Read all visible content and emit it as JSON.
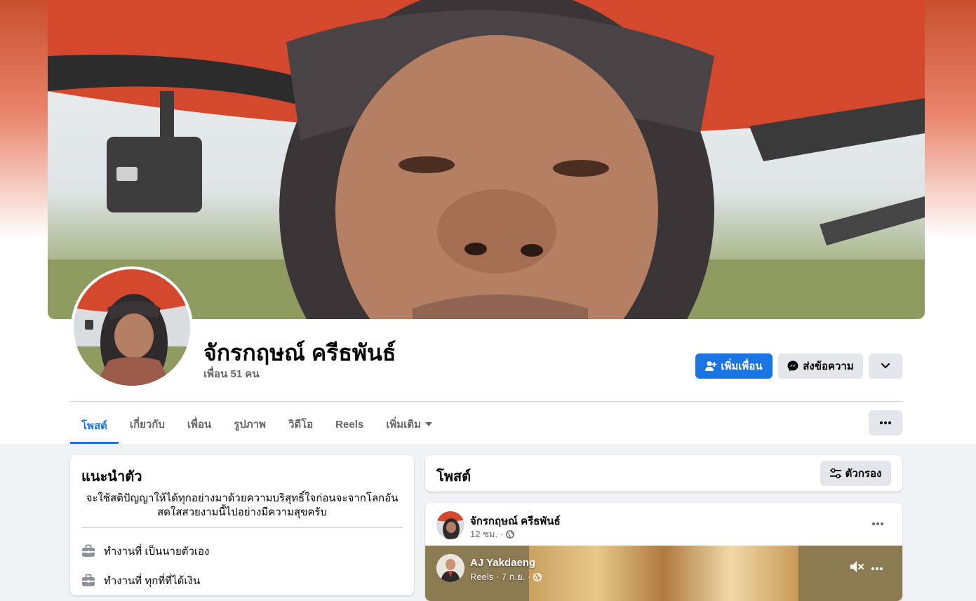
{
  "profile": {
    "name": "จักรกฤษณ์ ครีธพันธ์",
    "friends_count": "เพื่อน 51 คน"
  },
  "actions": {
    "add_friend": "เพิ่มเพื่อน",
    "message": "ส่งข้อความ"
  },
  "tabs": [
    {
      "label": "โพสต์",
      "active": true
    },
    {
      "label": "เกี่ยวกับ"
    },
    {
      "label": "เพื่อน"
    },
    {
      "label": "รูปภาพ"
    },
    {
      "label": "วิดีโอ"
    },
    {
      "label": "Reels"
    },
    {
      "label": "เพิ่มเติม"
    }
  ],
  "intro": {
    "title": "แนะนำตัว",
    "bio": "จะใช้สติปัญญาให้ได้ทุกอย่างมาด้วยความบริสุทธิ์ใจก่อนจะจากโลกอันสดใสสวยงามนี้ไปอย่างมีความสุขครับ",
    "items": [
      {
        "icon": "briefcase-icon",
        "text": "ทำงานที่ เป็นนายตัวเอง"
      },
      {
        "icon": "briefcase-icon",
        "text": "ทำงานที่ ทุกที่ที่ได้เงิน"
      }
    ]
  },
  "posts": {
    "title": "โพสต์",
    "filter_label": "ตัวกรอง",
    "items": [
      {
        "author": "จักรกฤษณ์ ครีธพันธ์",
        "time": "12 ชม. ·",
        "shared": {
          "author": "AJ Yakdaeng",
          "meta": "Reels · 7 ก.ย. ·"
        }
      }
    ]
  },
  "colors": {
    "accent": "#1b74e4",
    "secondary_text": "#65676b",
    "button_gray": "#e4e6eb"
  }
}
